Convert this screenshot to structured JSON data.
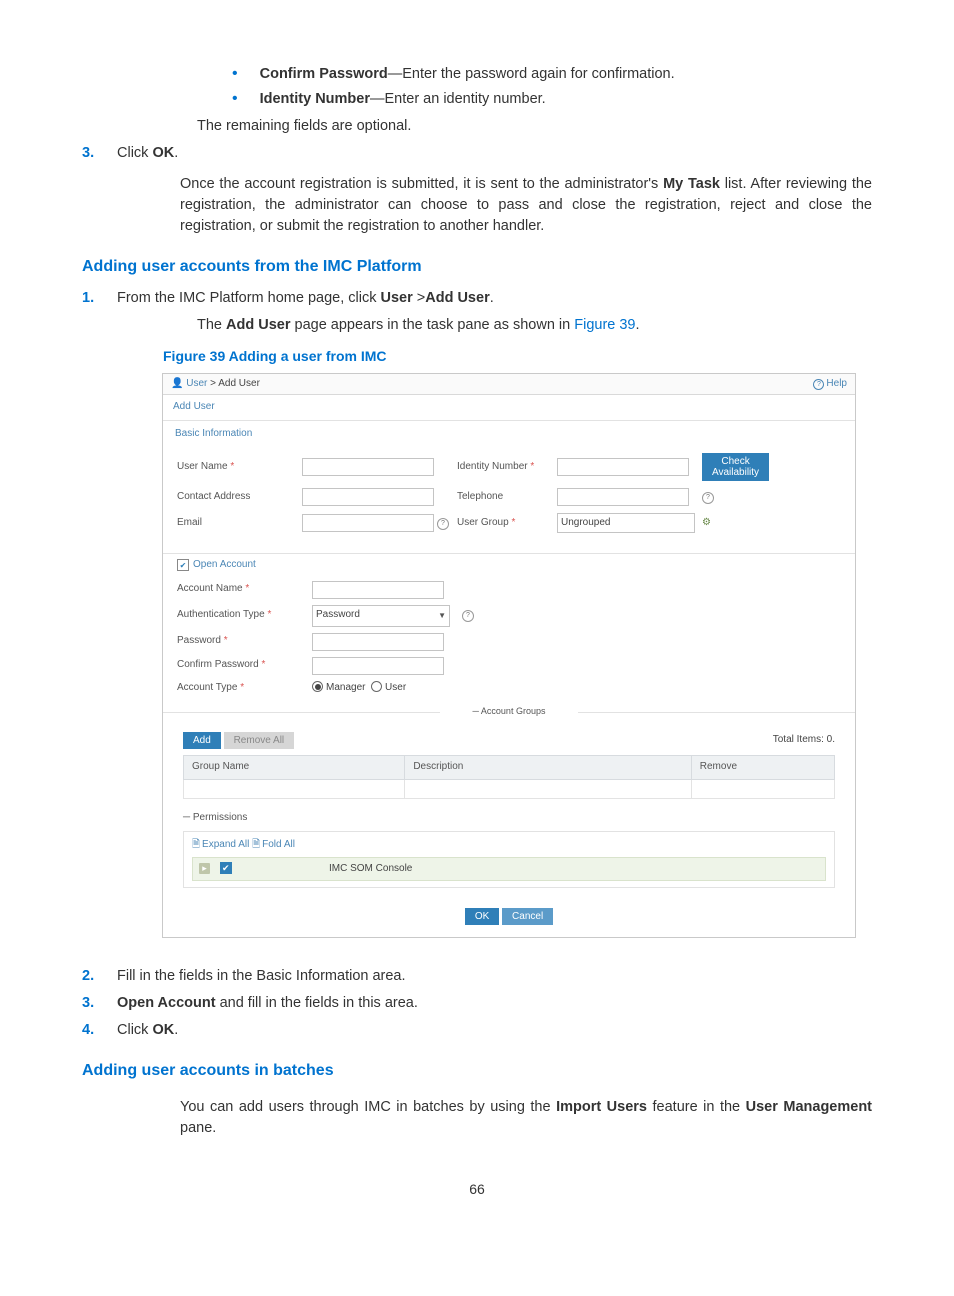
{
  "intro": {
    "bullets": [
      {
        "label": "Confirm Password",
        "sep": "—",
        "desc": "Enter the password again for confirmation."
      },
      {
        "label": "Identity Number",
        "sep": "—",
        "desc": "Enter an identity number."
      }
    ],
    "remaining": "The remaining fields are optional.",
    "step3_num": "3.",
    "step3_a": "Click ",
    "step3_b": "OK",
    "step3_c": ".",
    "after_a": "Once the account registration is submitted, it is sent to the administrator's ",
    "after_b": "My Task",
    "after_c": " list. After reviewing the registration, the administrator can choose to pass and close the registration, reject and close the registration, or submit the registration to another handler."
  },
  "sec_imc": {
    "heading": "Adding user accounts from the IMC Platform",
    "step1_num": "1.",
    "step1_a": "From the IMC Platform home page, click ",
    "step1_b": "User",
    "step1_c": " >",
    "step1_d": "Add User",
    "step1_e": ".",
    "step1_body_a": "The ",
    "step1_body_b": "Add User",
    "step1_body_c": " page appears in the task pane as shown in ",
    "step1_body_link": "Figure 39",
    "step1_body_d": ".",
    "fig_caption": "Figure 39 Adding a user from IMC"
  },
  "ss": {
    "breadcrumb_a": "User",
    "breadcrumb_sep": " > ",
    "breadcrumb_b": "Add User",
    "help": "Help",
    "section_add_user": "Add User",
    "panel_basic": "Basic Information",
    "labels": {
      "user_name": "User Name",
      "identity_number": "Identity Number",
      "contact_address": "Contact Address",
      "telephone": "Telephone",
      "email": "Email",
      "user_group": "User Group",
      "user_group_value": "Ungrouped",
      "check_avail": "Check Availability",
      "open_account": "Open Account",
      "account_name": "Account Name",
      "auth_type": "Authentication Type",
      "auth_type_value": "Password",
      "password": "Password",
      "confirm_password": "Confirm Password",
      "account_type": "Account Type",
      "radio_manager": "Manager",
      "radio_user": "User",
      "account_groups": "Account Groups",
      "add": "Add",
      "remove_all": "Remove All",
      "total_items": "Total Items: 0.",
      "col_group": "Group Name",
      "col_desc": "Description",
      "col_remove": "Remove",
      "permissions": "Permissions",
      "expand_all": "Expand All",
      "fold_all": "Fold All",
      "perm_item": "IMC SOM Console",
      "ok": "OK",
      "cancel": "Cancel"
    }
  },
  "after_fig": {
    "step2_num": "2.",
    "step2": "Fill in the fields in the Basic Information area.",
    "step3_num": "3.",
    "step3_b": "Open Account",
    "step3_rest": " and fill in the fields in this area.",
    "step4_num": "4.",
    "step4_a": "Click ",
    "step4_b": "OK",
    "step4_c": "."
  },
  "sec_batch": {
    "heading": "Adding user accounts in batches",
    "body_a": "You can add users through IMC in batches by using the ",
    "body_b": "Import Users",
    "body_c": " feature in the ",
    "body_d": "User Management",
    "body_e": " pane."
  },
  "page_number": "66"
}
